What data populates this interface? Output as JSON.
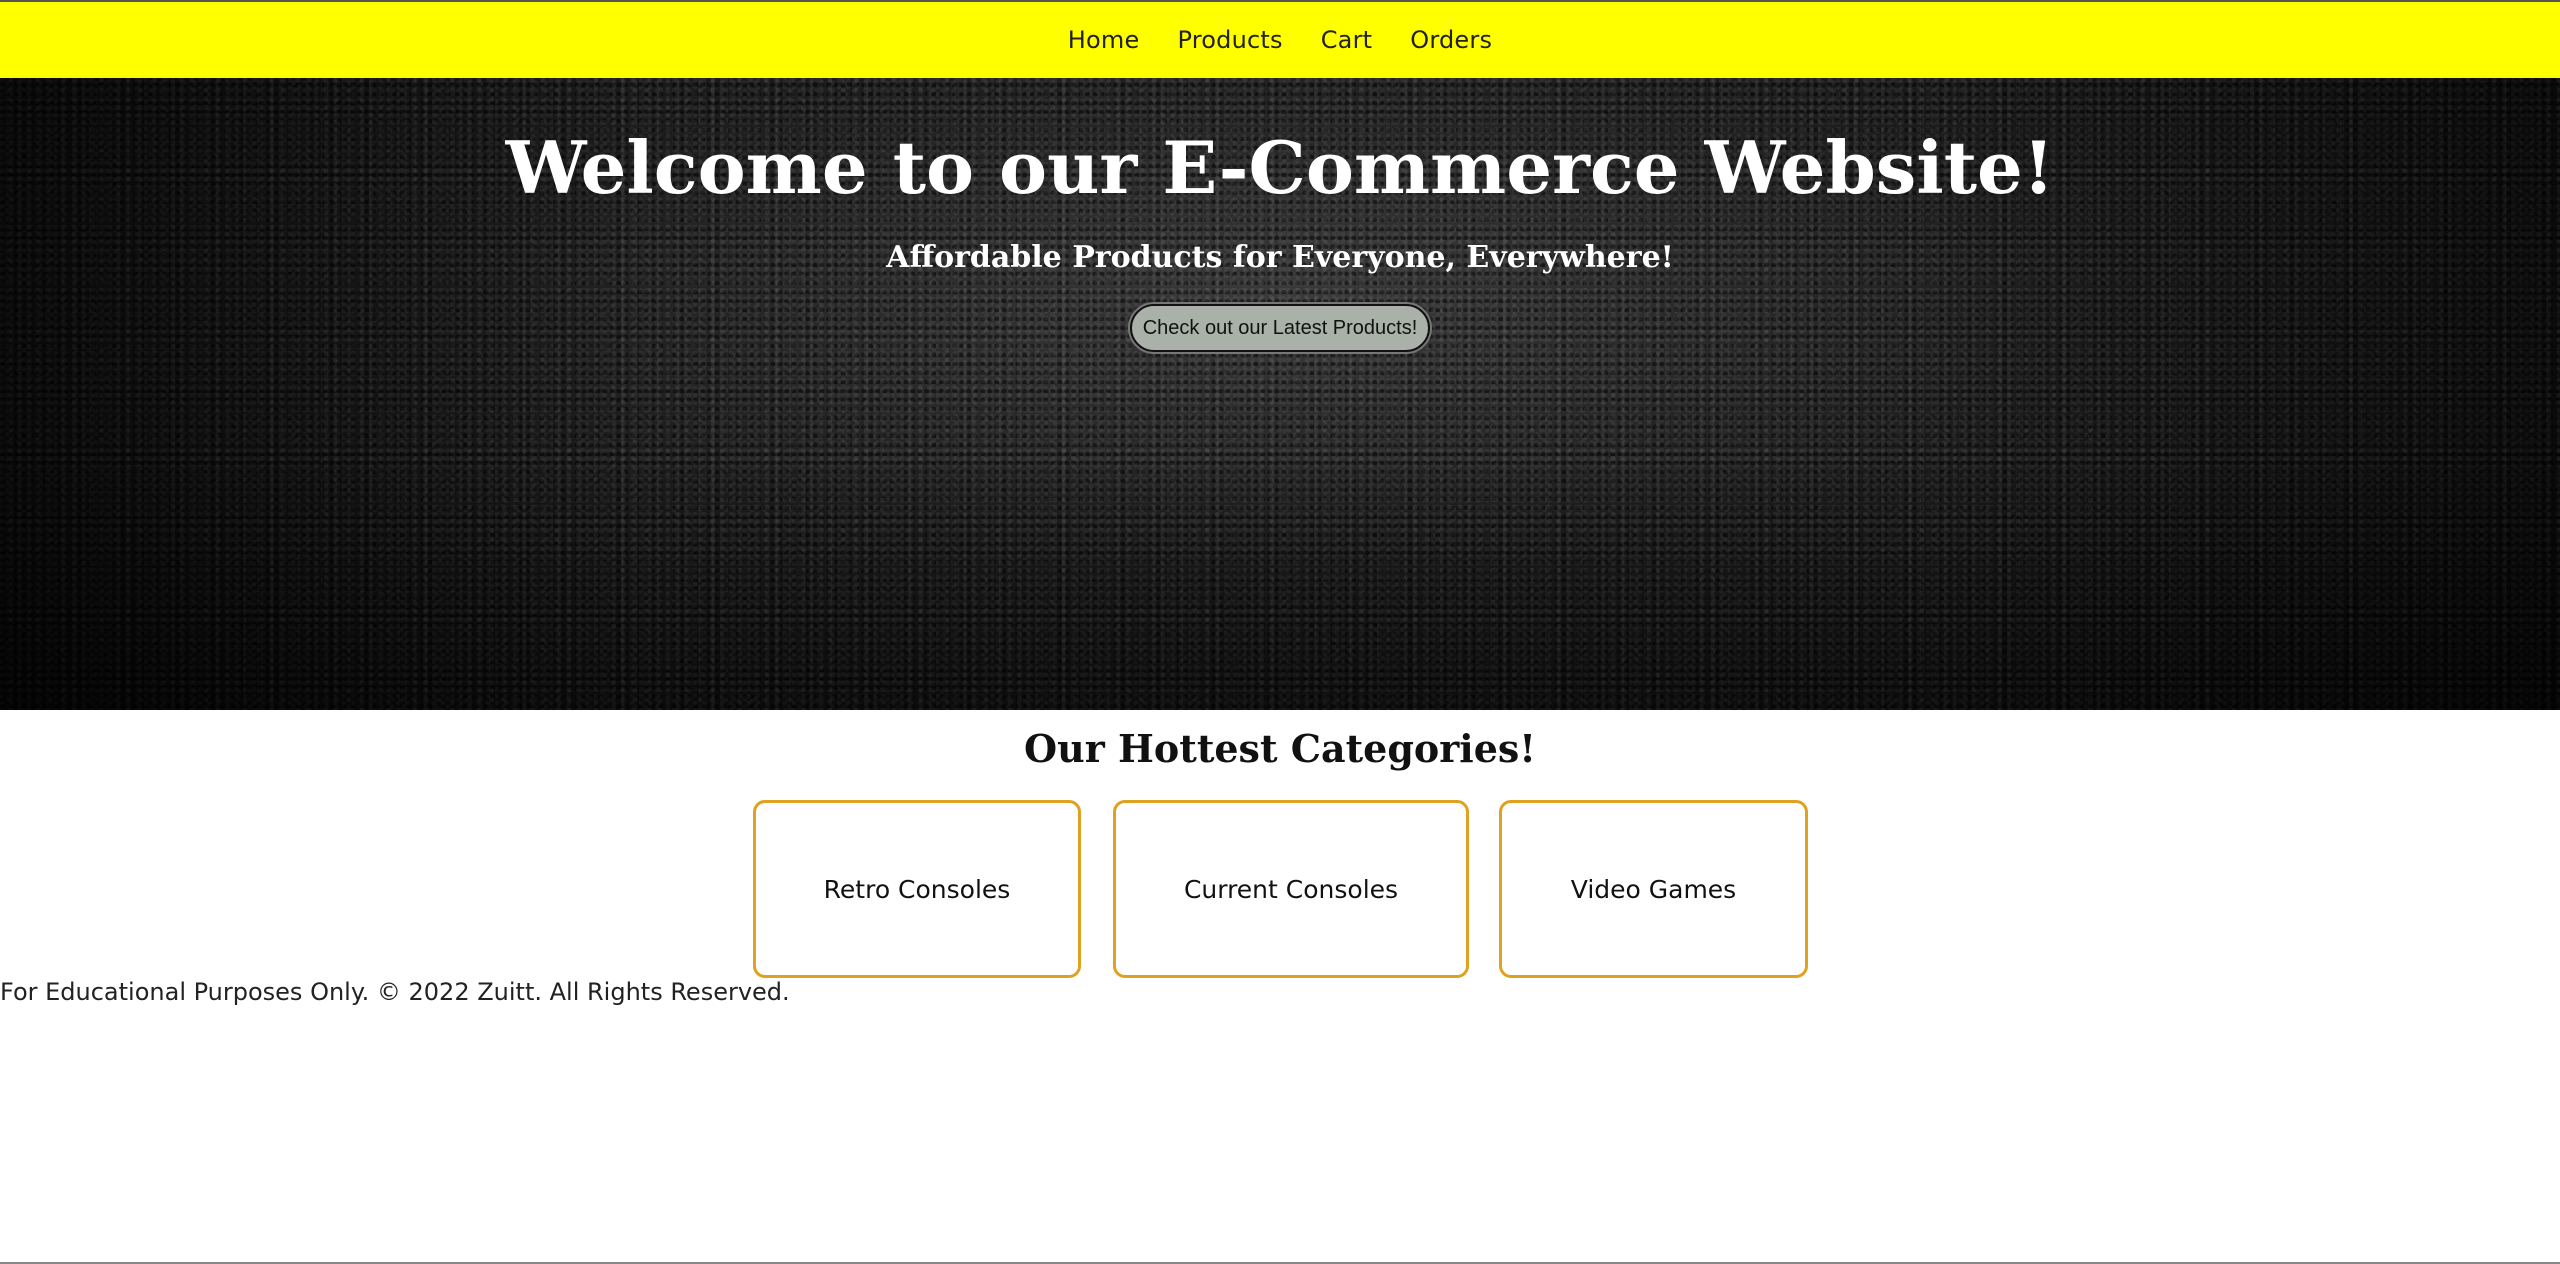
{
  "navbar": {
    "links": [
      "Home",
      "Products",
      "Cart",
      "Orders"
    ],
    "background": "#ffff00"
  },
  "hero": {
    "title": "Welcome to our E-Commerce Website!",
    "subtitle": "Affordable Products for Everyone, Everywhere!",
    "button_label": "Check out our Latest Products!"
  },
  "categories": {
    "title": "Our Hottest Categories!",
    "items": [
      "Retro Consoles",
      "Current Consoles",
      "Video Games"
    ],
    "border_color": "#e0a020"
  },
  "footer": {
    "text": "For Educational Purposes Only. © 2022 Zuitt. All Rights Reserved."
  }
}
